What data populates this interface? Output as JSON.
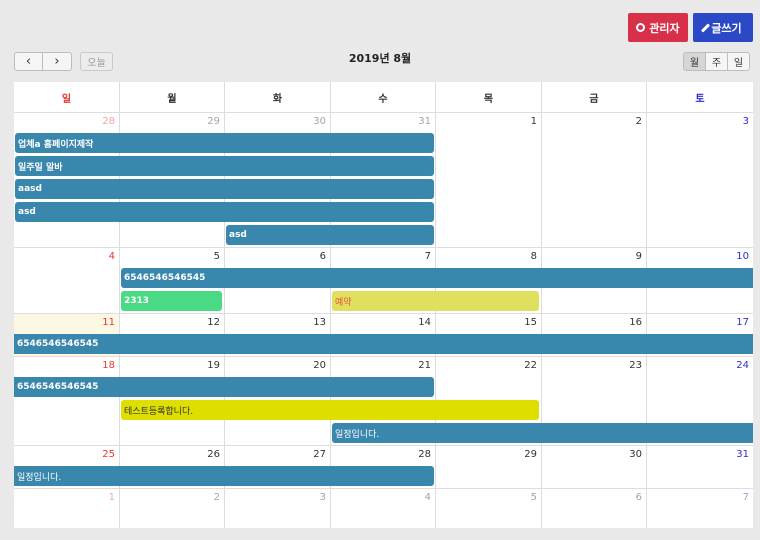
{
  "toolbar": {
    "admin_label": "관리자",
    "write_label": "글쓰기",
    "prev": "‹",
    "next": "›",
    "today_label": "오늘",
    "title": "2019년 8월",
    "views": [
      "월",
      "주",
      "일"
    ]
  },
  "weekdays": [
    "일",
    "월",
    "화",
    "수",
    "목",
    "금",
    "토"
  ],
  "colors": {
    "event": "#3a87ad",
    "admin": "#d9304a",
    "write": "#2b48c6",
    "sunday": "#e53935",
    "saturday": "#2c2ccf"
  },
  "weeks": [
    [
      "28",
      "29",
      "30",
      "31",
      "1",
      "2",
      "3"
    ],
    [
      "4",
      "5",
      "6",
      "7",
      "8",
      "9",
      "10"
    ],
    [
      "11",
      "12",
      "13",
      "14",
      "15",
      "16",
      "17"
    ],
    [
      "18",
      "19",
      "20",
      "21",
      "22",
      "23",
      "24"
    ],
    [
      "25",
      "26",
      "27",
      "28",
      "29",
      "30",
      "31"
    ],
    [
      "1",
      "2",
      "3",
      "4",
      "5",
      "6",
      "7"
    ]
  ],
  "events": {
    "e1": "업체a 홈페이지제작",
    "e2": "일주일 알바",
    "e3": "aasd",
    "e4": "asd",
    "e5": "asd",
    "e6": "6546546546545",
    "e7": "2313",
    "e8": "예약",
    "e9": "6546546546545",
    "e10": "6546546546545",
    "e11": "테스트등록합니다.",
    "e12": "일정입니다.",
    "e13": "일정입니다."
  }
}
